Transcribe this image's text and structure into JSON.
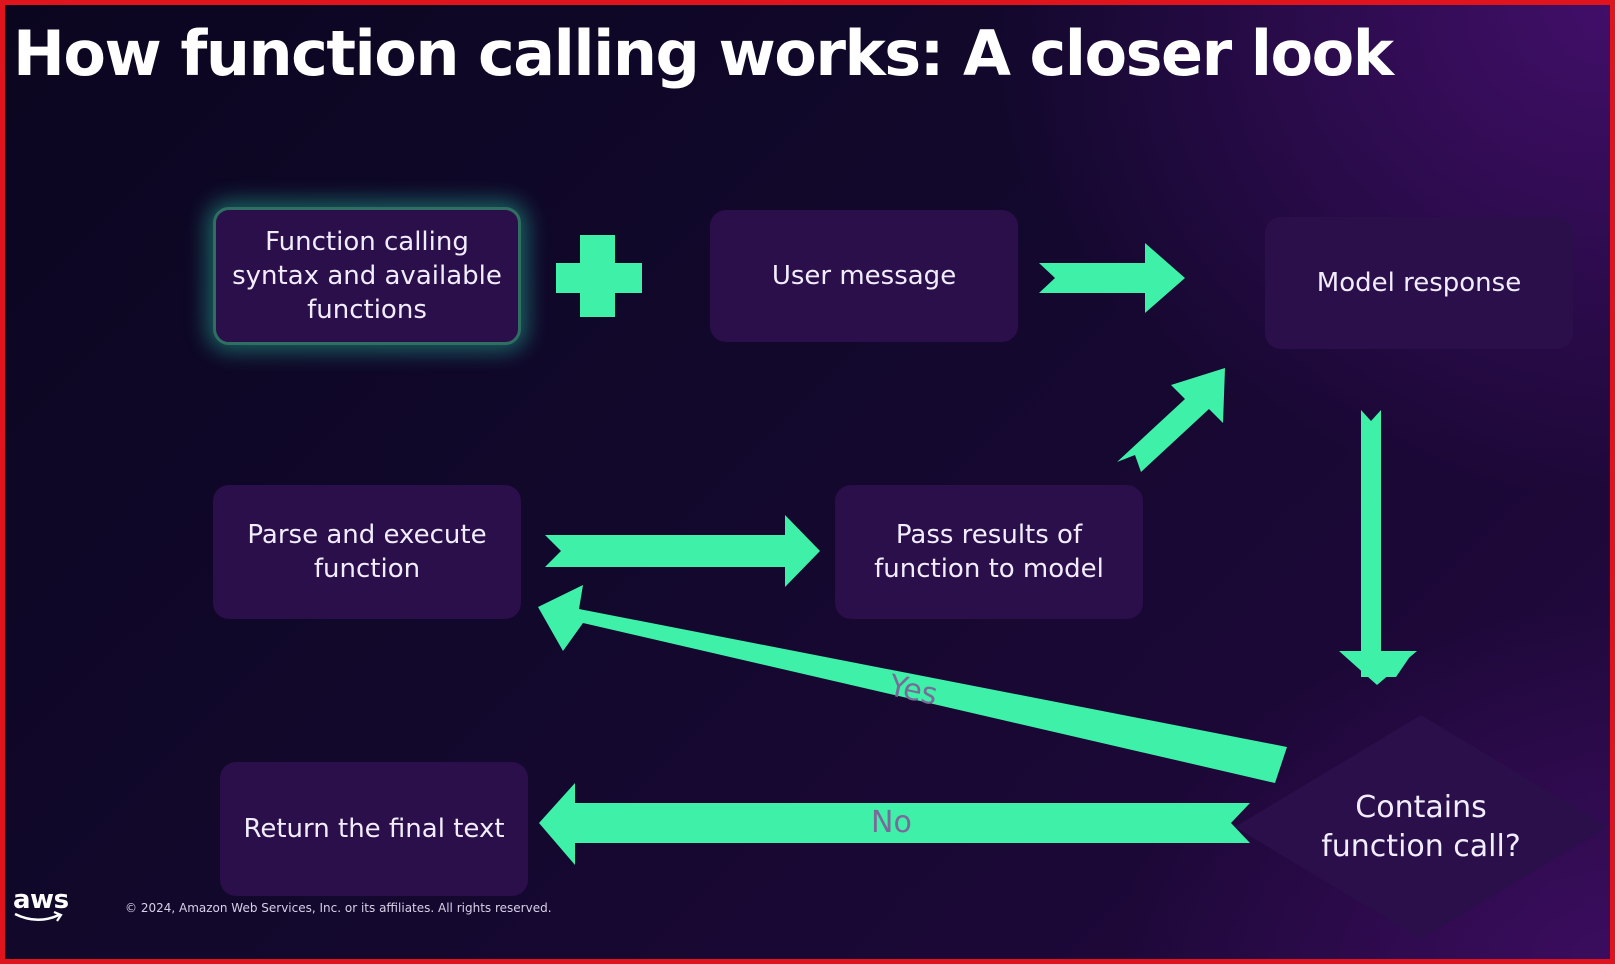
{
  "slide": {
    "title": "How function calling works: A closer look",
    "copyright": "© 2024, Amazon Web Services, Inc. or its affiliates. All rights reserved.",
    "logo_text": "aws"
  },
  "nodes": {
    "function_syntax": "Function calling syntax and available functions",
    "user_message": "User message",
    "model_response": "Model response",
    "parse_execute": "Parse and execute function",
    "pass_results": "Pass results of function to model",
    "return_text": "Return the final text",
    "decision": "Contains function call?"
  },
  "edges": {
    "yes_label": "Yes",
    "no_label": "No"
  },
  "colors": {
    "accent": "#3ff0a9",
    "node_fill": "#2a0f4a",
    "frame_border": "#e0141c"
  }
}
